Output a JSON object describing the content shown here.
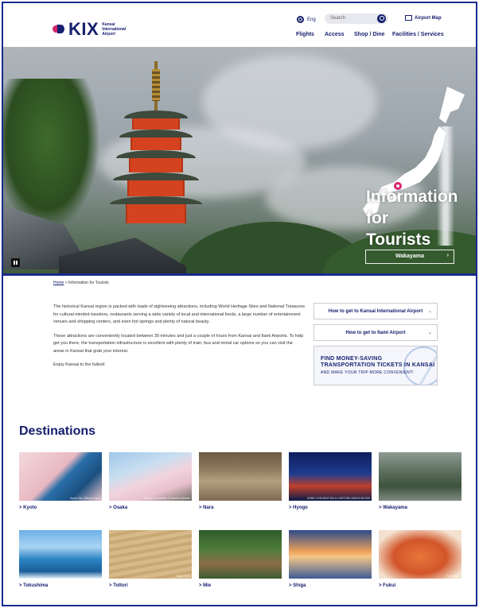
{
  "header": {
    "logo_text": "KIX",
    "logo_sub": "Kansai International Airport",
    "lang_label": "Eng",
    "search_placeholder": "Search",
    "map_label": "Airport Map",
    "nav": [
      "Flights",
      "Access",
      "Shop / Dine",
      "Facilities / Services"
    ]
  },
  "hero": {
    "title_lines": [
      "Information",
      "for",
      "Tourists"
    ],
    "button_label": "Wakayama"
  },
  "breadcrumb": {
    "home": "Home",
    "separator": ">",
    "current": "Information for Tourists"
  },
  "intro": {
    "p1": "The historical Kansai region is packed with loads of sightseeing attractions, including World Heritage Sites and National Treasures for cultural-minded travelers, restaurants serving a wide variety of local and international foods, a large number of entertainment venues and shopping centers, and even hot springs and plenty of natural beauty.",
    "p2": "These attractions are conveniently located between 30 minutes and just a couple of hours from Kansai and Itami Airports. To help get you there, the transportation infrastructure is excellent with plenty of train, bus and rental car options so you can visit the areas in Kansai that grab your interest.",
    "p3": "Enjoy Kansai to the fullest!"
  },
  "side": {
    "btn1": "How to get to Kansai International Airport",
    "btn2": "How to get to Itami Airport",
    "banner_line1": "FIND MONEY-SAVING",
    "banner_line2": "TRANSPORTATION TICKETS IN KANSAI",
    "banner_line3": "AND MAKE YOUR TRIP MORE CONVENIENT!"
  },
  "destinations": {
    "title": "Destinations",
    "items": [
      {
        "label": "> Kyoto",
        "caption": "Kyoto City Official Travel"
      },
      {
        "label": "> Osaka",
        "caption": "Osaka Convention & Tourism Bureau"
      },
      {
        "label": "> Nara",
        "caption": ""
      },
      {
        "label": "> Hyogo",
        "caption": "KOBE CONVENTION & VISITORS ASSOCIATION"
      },
      {
        "label": "> Wakayama",
        "caption": ""
      },
      {
        "label": "> Tokushima",
        "caption": ""
      },
      {
        "label": "> Tottori",
        "caption": "Tottori Pref."
      },
      {
        "label": "> Mie",
        "caption": ""
      },
      {
        "label": "> Shiga",
        "caption": ""
      },
      {
        "label": "> Fukui",
        "caption": "Fukui Pref."
      }
    ]
  },
  "colors": {
    "brand_navy": "#16206e",
    "accent_pink": "#d6246e"
  }
}
